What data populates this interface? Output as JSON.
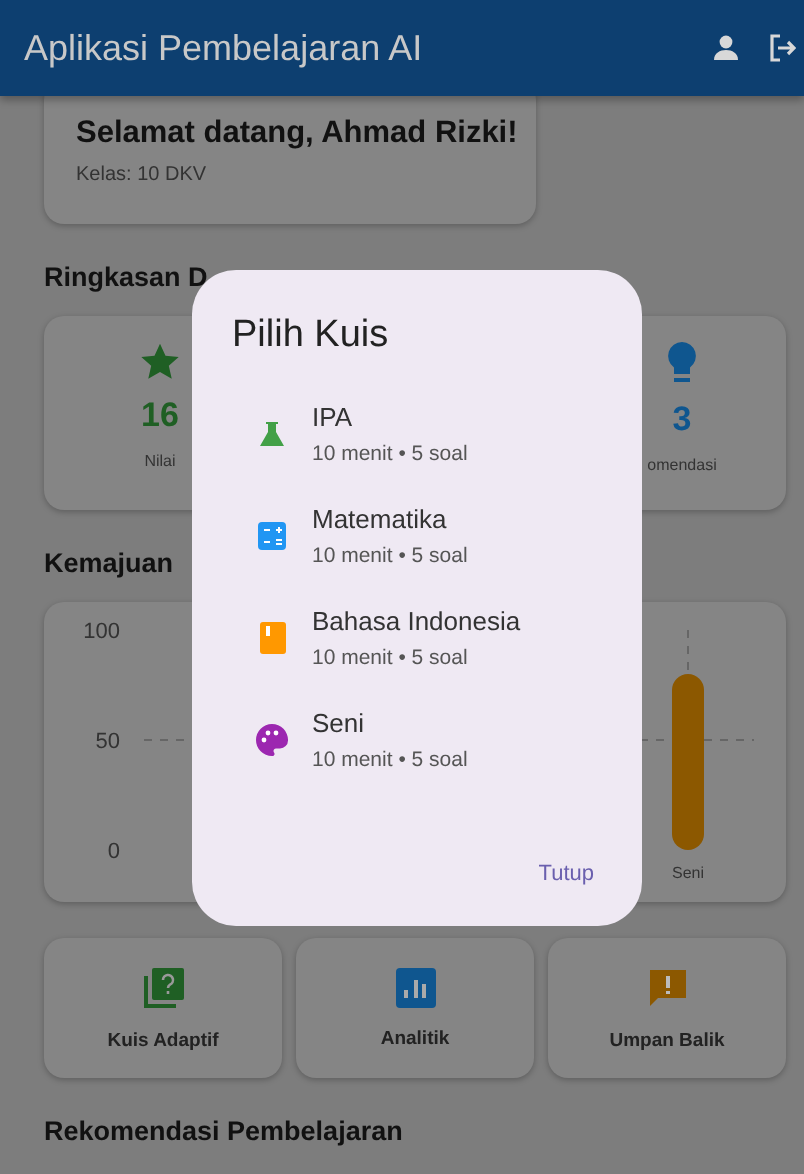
{
  "app_bar": {
    "title": "Aplikasi Pembelajaran AI"
  },
  "welcome": {
    "greeting": "Selamat datang, Ahmad Rizki!",
    "class_label": "Kelas: 10 DKV"
  },
  "summary": {
    "heading": "Ringkasan D",
    "stats": [
      {
        "kind": "star",
        "value": "16",
        "label": "Nilai",
        "color": "#1f5f24"
      },
      {
        "kind": "bulb",
        "value": "3",
        "label": "omendasi",
        "color": "#0f568f"
      }
    ]
  },
  "progress": {
    "heading": "Kemajuan",
    "chart_data": {
      "type": "bar",
      "categories": [
        "Seni"
      ],
      "series": [
        {
          "color": "#8c5800",
          "values": [
            80
          ]
        }
      ],
      "ylim": [
        0,
        100
      ],
      "yticks": [
        0,
        50,
        100
      ]
    }
  },
  "actions": [
    {
      "kind": "quiz",
      "label": "Kuis Adaptif",
      "color": "#1f5f24"
    },
    {
      "kind": "analytics",
      "label": "Analitik",
      "color": "#0f568f"
    },
    {
      "kind": "feedback",
      "label": "Umpan Balik",
      "color": "#8c5800"
    }
  ],
  "recommendations": {
    "heading": "Rekomendasi Pembelajaran"
  },
  "dialog": {
    "title": "Pilih Kuis",
    "quizzes": [
      {
        "kind": "science",
        "title": "IPA",
        "subtitle": "10 menit • 5 soal",
        "color": "#43a047"
      },
      {
        "kind": "math",
        "title": "Matematika",
        "subtitle": "10 menit • 5 soal",
        "color": "#2196f3"
      },
      {
        "kind": "book",
        "title": "Bahasa Indonesia",
        "subtitle": "10 menit • 5 soal",
        "color": "#ff9800"
      },
      {
        "kind": "art",
        "title": "Seni",
        "subtitle": "10 menit • 5 soal",
        "color": "#9c27b0"
      }
    ],
    "close": "Tutup"
  }
}
